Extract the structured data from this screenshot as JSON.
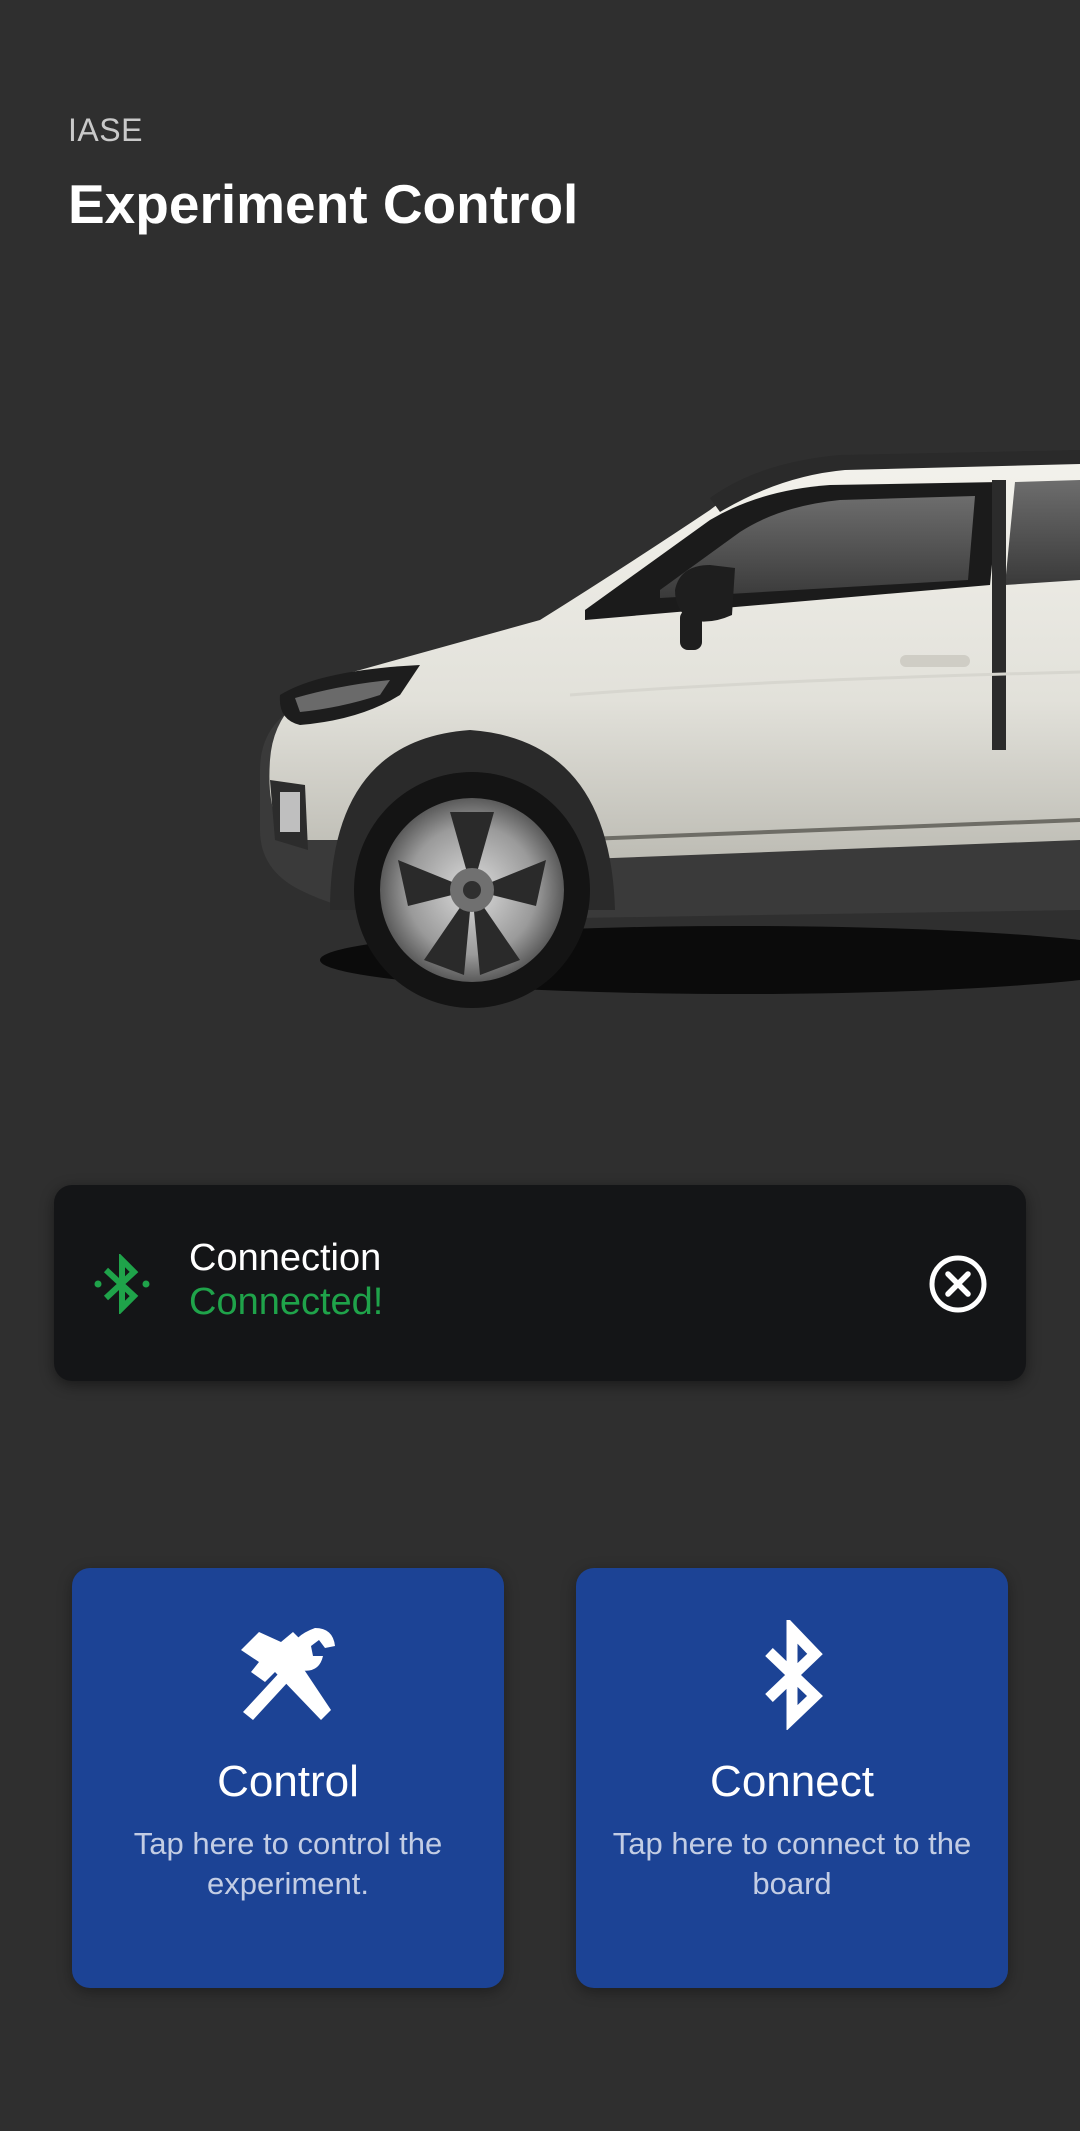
{
  "header": {
    "app_label": "IASE",
    "title": "Experiment Control"
  },
  "status_card": {
    "icon": "bluetooth-icon",
    "title": "Connection",
    "value": "Connected!",
    "status_color": "#1fa34a",
    "close_icon": "close-circle-icon"
  },
  "actions": [
    {
      "icon": "tools-icon",
      "title": "Control",
      "description": "Tap here to control the experiment."
    },
    {
      "icon": "bluetooth-icon",
      "title": "Connect",
      "description": "Tap here to connect to the board"
    }
  ],
  "colors": {
    "background": "#2f2f2f",
    "card_dark": "#141517",
    "card_blue": "#1c4395"
  }
}
